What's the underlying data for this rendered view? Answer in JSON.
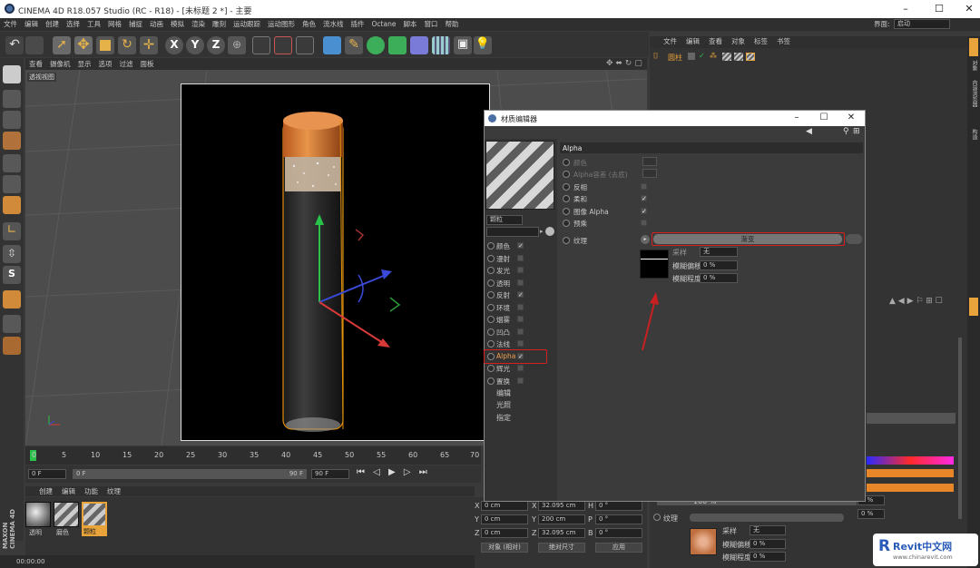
{
  "window": {
    "title": "CINEMA 4D R18.057 Studio (RC - R18) - [未标题 2 *] - 主要"
  },
  "menubar": [
    "文件",
    "编辑",
    "创建",
    "选择",
    "工具",
    "网格",
    "捕捉",
    "动画",
    "模拟",
    "渲染",
    "雕刻",
    "运动跟踪",
    "运动图形",
    "角色",
    "流水线",
    "插件",
    "Octane",
    "脚本",
    "窗口",
    "帮助"
  ],
  "layout": {
    "label": "界面:",
    "value": "启动"
  },
  "viewport": {
    "menu": [
      "查看",
      "摄像机",
      "显示",
      "选项",
      "过滤",
      "面板"
    ],
    "label": "透视视图"
  },
  "timeline": {
    "ticks": [
      "0",
      "5",
      "10",
      "15",
      "20",
      "25",
      "30",
      "35",
      "40",
      "45",
      "50",
      "55",
      "60",
      "65",
      "70"
    ],
    "start": "0 F",
    "current": "0 F",
    "end_mid": "90 F",
    "end": "90 F"
  },
  "material_manager": {
    "menu": [
      "创建",
      "编辑",
      "功能",
      "纹理"
    ],
    "materials": [
      "透明",
      "磨色",
      "颗粒"
    ]
  },
  "status": {
    "time": "00:00:00"
  },
  "coords": {
    "rows": [
      {
        "a": "X",
        "av": "0 cm",
        "b": "X",
        "bv": "32.095 cm",
        "c": "H",
        "cv": "0 °"
      },
      {
        "a": "Y",
        "av": "0 cm",
        "b": "Y",
        "bv": "200 cm",
        "c": "P",
        "cv": "0 °"
      },
      {
        "a": "Z",
        "av": "0 cm",
        "b": "Z",
        "bv": "32.095 cm",
        "c": "B",
        "cv": "0 °"
      }
    ],
    "mode1": "对象 (相对)",
    "mode2": "绝对尺寸",
    "apply": "应用"
  },
  "object_manager": {
    "menu": [
      "文件",
      "编辑",
      "查看",
      "对象",
      "标签",
      "书签"
    ],
    "object_name": "圆柱"
  },
  "right_tabs": [
    "对象",
    "内容浏览器",
    "构造"
  ],
  "attr": {
    "pct": "100 %",
    "pct2": "0 %",
    "pct3": "0 %",
    "texture_label": "纹理",
    "sample_label": "采样",
    "sample_value": "无",
    "blur_offset_label": "模糊偏移",
    "blur_offset_value": "0 %",
    "blur_scale_label": "模糊程度",
    "blur_scale_value": "0 %"
  },
  "dialog": {
    "title": "材质编辑器",
    "name_field": "颗粒",
    "channels": [
      {
        "label": "颜色",
        "check": "✓"
      },
      {
        "label": "漫射",
        "check": ""
      },
      {
        "label": "发光",
        "check": ""
      },
      {
        "label": "透明",
        "check": ""
      },
      {
        "label": "反射",
        "check": "✓"
      },
      {
        "label": "环境",
        "check": ""
      },
      {
        "label": "烟雾",
        "check": ""
      },
      {
        "label": "凹凸",
        "check": ""
      },
      {
        "label": "法线",
        "check": ""
      },
      {
        "label": "Alpha",
        "check": "✓"
      },
      {
        "label": "辉光",
        "check": ""
      },
      {
        "label": "置换",
        "check": ""
      }
    ],
    "extras": [
      "编辑",
      "光照",
      "指定"
    ],
    "section": "Alpha",
    "props": [
      {
        "label": "颜色",
        "check": ""
      },
      {
        "label": "Alpha容差 (去底)",
        "check": ""
      },
      {
        "label": "反相",
        "check": ""
      },
      {
        "label": "柔和",
        "check": "✓"
      },
      {
        "label": "图像 Alpha",
        "check": "✓"
      },
      {
        "label": "预乘",
        "check": ""
      }
    ],
    "texture_label": "纹理",
    "texture_value": "渐变",
    "sample_label": "采样",
    "sample_value": "无",
    "blur_offset_label": "模糊偏移",
    "blur_offset_value": "0 %",
    "blur_scale_label": "模糊程度",
    "blur_scale_value": "0 %"
  },
  "watermark": {
    "brand": "Revit中文网",
    "url": "www.chinarevit.com"
  },
  "vertical_brand": "MAXON CINEMA 4D",
  "colors": {
    "accent": "#e8a33a",
    "highlight": "#d52020",
    "panel": "#333333"
  }
}
